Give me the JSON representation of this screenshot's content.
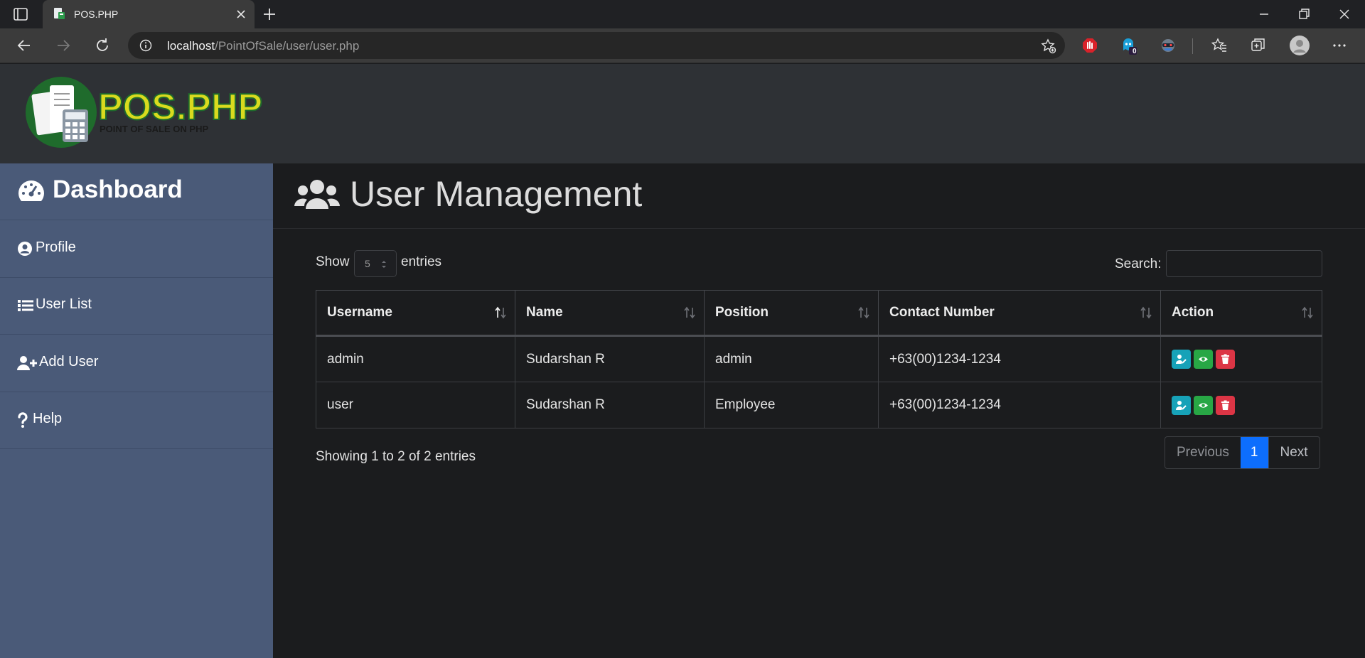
{
  "browser": {
    "tab_title": "POS.PHP",
    "url_host": "localhost",
    "url_path": "/PointOfSale/user/user.php",
    "extension_badge": "0"
  },
  "site": {
    "logo_text": "POS.PHP",
    "logo_tagline": "POINT OF SALE ON PHP"
  },
  "sidebar": {
    "items": [
      {
        "label": "Dashboard",
        "icon": "tachometer-icon"
      },
      {
        "label": "Profile",
        "icon": "user-circle-icon"
      },
      {
        "label": "User List",
        "icon": "list-icon"
      },
      {
        "label": "Add User",
        "icon": "user-plus-icon"
      },
      {
        "label": "Help",
        "icon": "question-icon"
      }
    ]
  },
  "page": {
    "title": "User Management",
    "icon": "users-icon"
  },
  "table_controls": {
    "show_label": "Show",
    "length_value": "5",
    "entries_label": "entries",
    "search_label": "Search:",
    "search_value": ""
  },
  "table": {
    "columns": [
      "Username",
      "Name",
      "Position",
      "Contact Number",
      "Action"
    ],
    "rows": [
      {
        "username": "admin",
        "name": "Sudarshan R",
        "position": "admin",
        "contact": "+63(00)1234-1234"
      },
      {
        "username": "user",
        "name": "Sudarshan R",
        "position": "Employee",
        "contact": "+63(00)1234-1234"
      }
    ]
  },
  "footer": {
    "info": "Showing 1 to 2 of 2 entries",
    "previous": "Previous",
    "current_page": "1",
    "next": "Next"
  },
  "colors": {
    "sidebar_bg": "#4a5a78",
    "edit_button": "#17a2b8",
    "view_button": "#28a745",
    "delete_button": "#dc3545",
    "active_page": "#0d6efd"
  }
}
